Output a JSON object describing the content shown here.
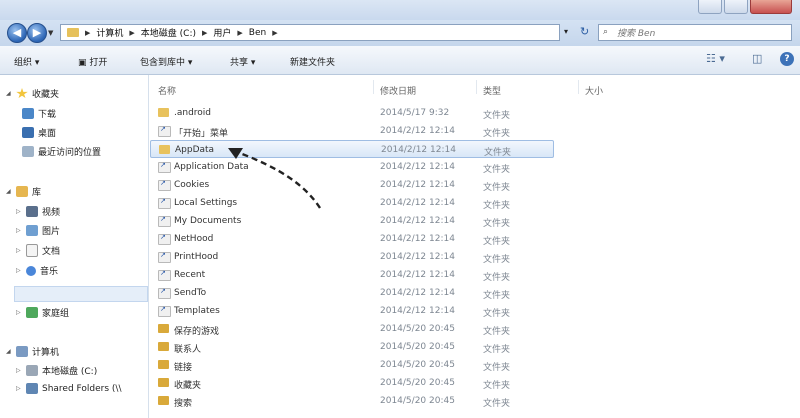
{
  "addressbar": {
    "crumbs": [
      "计算机",
      "本地磁盘 (C:)",
      "用户",
      "Ben"
    ],
    "search_placeholder": "搜索 Ben"
  },
  "toolbar": {
    "organize": "组织 ▾",
    "open": "打开",
    "include_in_library": "包含到库中 ▾",
    "share": "共享 ▾",
    "new_folder": "新建文件夹"
  },
  "columns": {
    "name": "名称",
    "date": "修改日期",
    "type": "类型",
    "size": "大小"
  },
  "nav": {
    "favorites": "收藏夹",
    "downloads": "下载",
    "desktop": "桌面",
    "recent": "最近访问的位置",
    "libraries": "库",
    "videos": "视频",
    "pictures": "图片",
    "documents": "文档",
    "music": "音乐",
    "homegroup": "家庭组",
    "computer": "计算机",
    "local_disk": "本地磁盘 (C:)",
    "shared_folders": "Shared Folders (\\\\"
  },
  "files": [
    {
      "name": ".android",
      "date": "2014/5/17 9:32",
      "type": "文件夹",
      "icon": "folder"
    },
    {
      "name": "「开始」菜单",
      "date": "2014/2/12 12:14",
      "type": "文件夹",
      "icon": "shortcut"
    },
    {
      "name": "AppData",
      "date": "2014/2/12 12:14",
      "type": "文件夹",
      "icon": "folder",
      "selected": true
    },
    {
      "name": "Application Data",
      "date": "2014/2/12 12:14",
      "type": "文件夹",
      "icon": "shortcut"
    },
    {
      "name": "Cookies",
      "date": "2014/2/12 12:14",
      "type": "文件夹",
      "icon": "shortcut"
    },
    {
      "name": "Local Settings",
      "date": "2014/2/12 12:14",
      "type": "文件夹",
      "icon": "shortcut"
    },
    {
      "name": "My Documents",
      "date": "2014/2/12 12:14",
      "type": "文件夹",
      "icon": "shortcut"
    },
    {
      "name": "NetHood",
      "date": "2014/2/12 12:14",
      "type": "文件夹",
      "icon": "shortcut"
    },
    {
      "name": "PrintHood",
      "date": "2014/2/12 12:14",
      "type": "文件夹",
      "icon": "shortcut"
    },
    {
      "name": "Recent",
      "date": "2014/2/12 12:14",
      "type": "文件夹",
      "icon": "shortcut"
    },
    {
      "name": "SendTo",
      "date": "2014/2/12 12:14",
      "type": "文件夹",
      "icon": "shortcut"
    },
    {
      "name": "Templates",
      "date": "2014/2/12 12:14",
      "type": "文件夹",
      "icon": "shortcut"
    },
    {
      "name": "保存的游戏",
      "date": "2014/5/20 20:45",
      "type": "文件夹",
      "icon": "special"
    },
    {
      "name": "联系人",
      "date": "2014/5/20 20:45",
      "type": "文件夹",
      "icon": "special"
    },
    {
      "name": "链接",
      "date": "2014/5/20 20:45",
      "type": "文件夹",
      "icon": "special"
    },
    {
      "name": "收藏夹",
      "date": "2014/5/20 20:45",
      "type": "文件夹",
      "icon": "special"
    },
    {
      "name": "搜索",
      "date": "2014/5/20 20:45",
      "type": "文件夹",
      "icon": "special"
    }
  ],
  "colors": {
    "selection": "#d8e7f7",
    "accent": "#3d72b8"
  }
}
